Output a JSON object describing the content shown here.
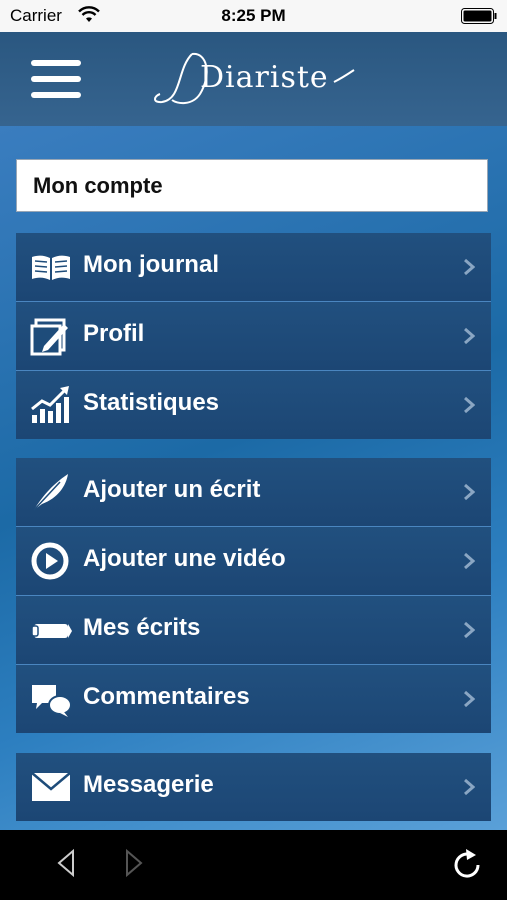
{
  "status_bar": {
    "carrier": "Carrier",
    "time": "8:25 PM"
  },
  "header": {
    "logo_text": "Diariste"
  },
  "account": {
    "title": "Mon compte"
  },
  "groups": [
    {
      "items": [
        {
          "label": "Mon journal",
          "icon": "book-icon"
        },
        {
          "label": "Profil",
          "icon": "edit-profile-icon"
        },
        {
          "label": "Statistiques",
          "icon": "chart-up-icon"
        }
      ]
    },
    {
      "items": [
        {
          "label": "Ajouter un écrit",
          "icon": "feather-icon"
        },
        {
          "label": "Ajouter une vidéo",
          "icon": "play-circle-icon"
        },
        {
          "label": "Mes écrits",
          "icon": "pencil-icon"
        },
        {
          "label": "Commentaires",
          "icon": "comments-icon"
        }
      ]
    },
    {
      "items": [
        {
          "label": "Messagerie",
          "icon": "envelope-icon"
        }
      ]
    }
  ],
  "colors": {
    "accent": "#1e4c7a",
    "nav": "#2a5780",
    "background": "#1c6aa6"
  }
}
